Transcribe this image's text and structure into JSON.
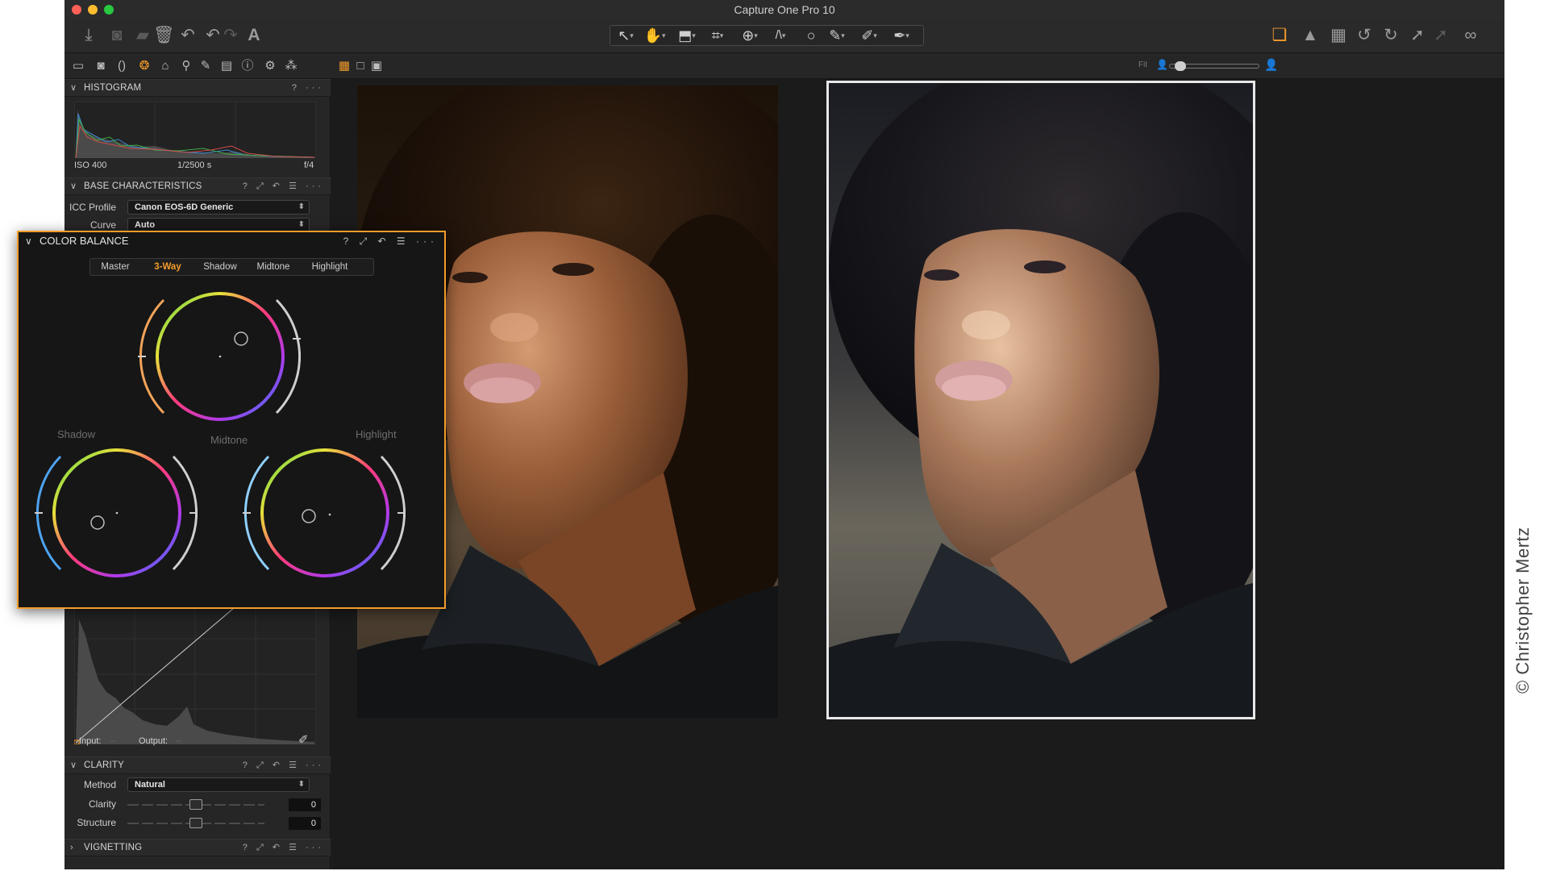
{
  "window": {
    "title": "Capture One Pro 10",
    "traffic_colors": [
      "#fe5f57",
      "#febc2e",
      "#28c840"
    ]
  },
  "toolbar": {
    "left_icons": [
      "import-icon",
      "camera-icon",
      "folder-move-icon",
      "trash-icon",
      "undo-all-icon",
      "undo-icon",
      "redo-icon",
      "text-tool-icon"
    ],
    "tools": [
      "↖",
      "✋",
      "⬒",
      "⌗",
      "⊕",
      "/\\",
      "○",
      "✎",
      "✐",
      "✒"
    ],
    "right_icons": [
      "layers-icon",
      "warning-icon",
      "grid-icon",
      "rotate-left-icon",
      "rotate-right-icon",
      "share-icon",
      "lock-icon",
      "glasses-icon"
    ],
    "accent": "#f49c2a"
  },
  "viewer_bar": {
    "zoom_label": "Fit"
  },
  "histogram": {
    "title": "HISTOGRAM",
    "iso": "ISO 400",
    "shutter": "1/2500 s",
    "aperture": "f/4"
  },
  "base_characteristics": {
    "title": "BASE CHARACTERISTICS",
    "icc_label": "ICC Profile",
    "icc_value": "Canon EOS-6D Generic",
    "curve_label": "Curve",
    "curve_value": "Auto"
  },
  "color_balance": {
    "title": "COLOR BALANCE",
    "tabs": [
      {
        "label": "Master",
        "active": false
      },
      {
        "label": "3-Way",
        "active": true
      },
      {
        "label": "Shadow",
        "active": false
      },
      {
        "label": "Midtone",
        "active": false
      },
      {
        "label": "Highlight",
        "active": false
      }
    ],
    "wheel_labels": {
      "shadow": "Shadow",
      "midtone": "Midtone",
      "highlight": "Highlight"
    }
  },
  "curve": {
    "input_label": "Input:",
    "input_value": "--",
    "output_label": "Output:",
    "output_value": "--"
  },
  "clarity": {
    "title": "CLARITY",
    "method_label": "Method",
    "method_value": "Natural",
    "clarity_label": "Clarity",
    "clarity_value": "0",
    "structure_label": "Structure",
    "structure_value": "0"
  },
  "vignetting": {
    "title": "VIGNETTING"
  },
  "panel_actions": "? ⤢ ↶ ☰ ···",
  "credit": "© Christopher Mertz"
}
